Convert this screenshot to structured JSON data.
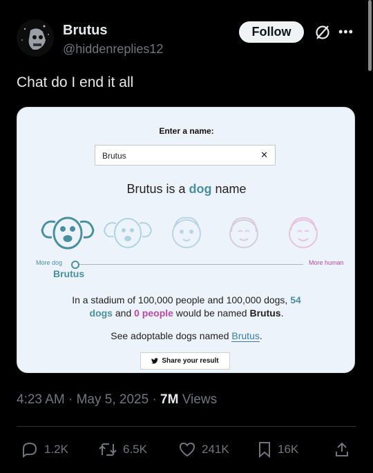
{
  "user": {
    "name": "Brutus",
    "handle": "@hiddenreplies12"
  },
  "follow_label": "Follow",
  "more_label": "•••",
  "tweet_text": "Chat do I end it all",
  "card": {
    "enter_label": "Enter a name:",
    "input_value": "Brutus",
    "clear_label": "✕",
    "headline_name": "Brutus",
    "headline_mid": " is a ",
    "headline_kind": "dog",
    "headline_end": " name",
    "more_dog": "More dog",
    "more_human": "More human",
    "marker_name": "Brutus",
    "stat": {
      "p1": "In a stadium of 100,000 people and 100,000 dogs, ",
      "dogs_count": "54",
      "dogs_word": "dogs",
      "and": " and ",
      "people": "0 people",
      "p2": " would be named ",
      "name": "Brutus",
      "end": "."
    },
    "adopt_prefix": "See adoptable dogs named ",
    "adopt_link": "Brutus",
    "adopt_end": ".",
    "share_label": "Share your result",
    "colors": {
      "dog": "#4a8f9e",
      "human": "#b84aa6"
    },
    "scale_position": 0
  },
  "meta": {
    "time": "4:23 AM · May 5, 2025 · ",
    "views_count": "7M",
    "views_label": " Views"
  },
  "actions": {
    "replies": "1.2K",
    "reposts": "6.5K",
    "likes": "241K",
    "bookmarks": "16K"
  }
}
